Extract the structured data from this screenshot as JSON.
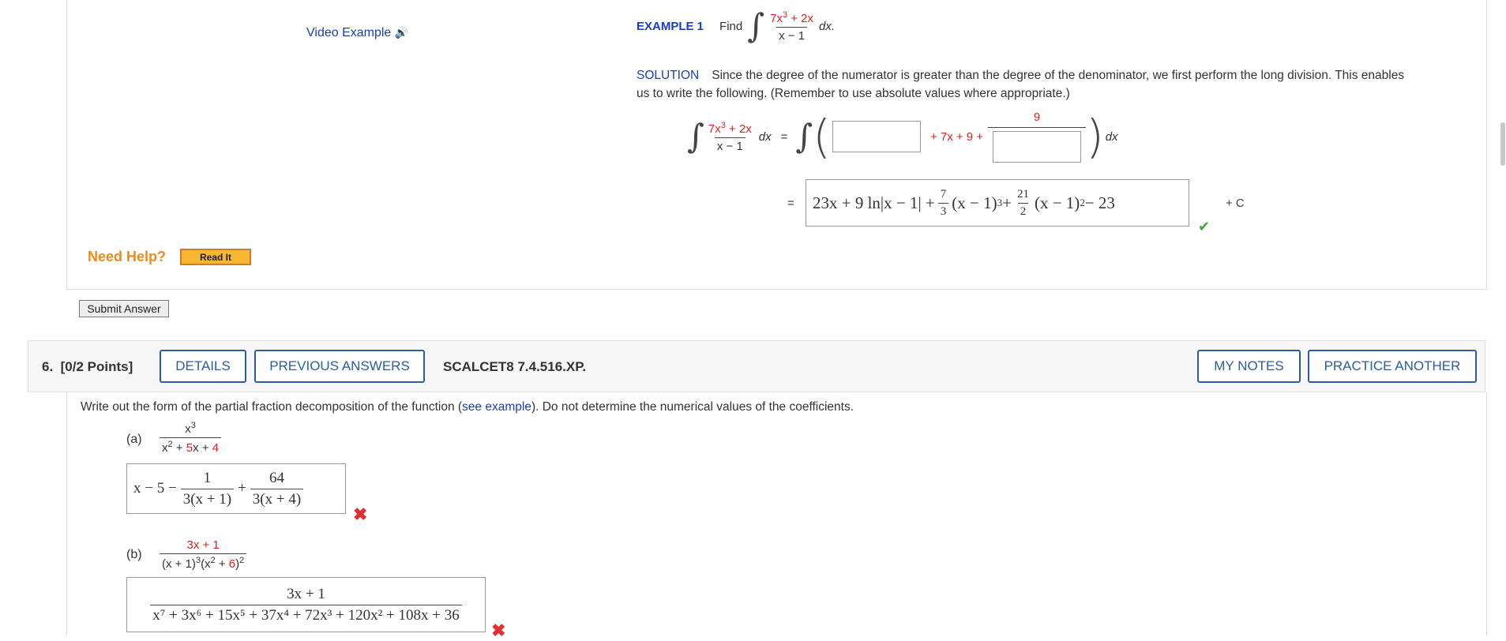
{
  "top": {
    "video_example": "Video Example",
    "example_label": "EXAMPLE 1",
    "find_label": "Find",
    "integrand_num": "7x",
    "integrand_num_exp": "3",
    "integrand_num_rest": " + 2x",
    "integrand_den": "x − 1",
    "dx": "dx.",
    "solution_label": "SOLUTION",
    "solution_text_1": "Since the degree of the numerator is greater than the degree of the denominator, we first perform the long division. This enables",
    "solution_text_2": "us to write the following. (Remember to use absolute values where appropriate.)",
    "eq_lhs_num": "7x",
    "eq_lhs_num_exp": "3",
    "eq_lhs_num_rest": " + 2x",
    "eq_lhs_den": "x − 1",
    "eq_dx": "dx",
    "eq_equals": "=",
    "eq_middle_terms": "+ 7x + 9 +",
    "eq_frac_num": "9",
    "eq_rhs_dx": "dx",
    "eq2_equals": "=",
    "answer_text_a": "23x + 9 ln|x − 1| +",
    "answer_frac1_num": "7",
    "answer_frac1_den": "3",
    "answer_text_b": "(x − 1)",
    "answer_exp1": "3",
    "answer_plus": " +",
    "answer_frac2_num": "21",
    "answer_frac2_den": "2",
    "answer_text_c": "(x − 1)",
    "answer_exp2": "2",
    "answer_text_d": " − 23",
    "plus_c": "+ C",
    "check_mark": "✔",
    "need_help": "Need Help?",
    "read_it": "Read It",
    "submit": "Submit Answer"
  },
  "question": {
    "number": "6.",
    "points": "[0/2 Points]",
    "details": "DETAILS",
    "previous_answers": "PREVIOUS ANSWERS",
    "code": "SCALCET8 7.4.516.XP.",
    "my_notes": "MY NOTES",
    "practice_another": "PRACTICE ANOTHER",
    "prompt_a": "Write out the form of the partial fraction decomposition of the function (",
    "see_example": "see example",
    "prompt_b": "). Do not determine the numerical values of the coefficients.",
    "part_a_label": "(a)",
    "part_a_num": "x",
    "part_a_num_exp": "3",
    "part_a_den_1": "x",
    "part_a_den_exp": "2",
    "part_a_den_2": " + ",
    "part_a_den_3": "5",
    "part_a_den_4": "x + ",
    "part_a_den_5": "4",
    "ans_a_lead": "x − 5 −",
    "ans_a_f1_num": "1",
    "ans_a_f1_den": "3(x + 1)",
    "ans_a_plus": "+",
    "ans_a_f2_num": "64",
    "ans_a_f2_den": "3(x + 4)",
    "part_b_label": "(b)",
    "part_b_num_1": "3",
    "part_b_num_2": "x + 1",
    "part_b_den_1": "(x + 1)",
    "part_b_den_exp1": "3",
    "part_b_den_2": "(x",
    "part_b_den_exp2": "2",
    "part_b_den_3": " + ",
    "part_b_den_4": "6",
    "part_b_den_5": ")",
    "part_b_den_exp3": "2",
    "ans_b_num": "3x + 1",
    "ans_b_den": "x⁷ + 3x⁶ + 15x⁵ + 37x⁴ + 72x³ + 120x² + 108x + 36",
    "x_mark": "✖"
  }
}
